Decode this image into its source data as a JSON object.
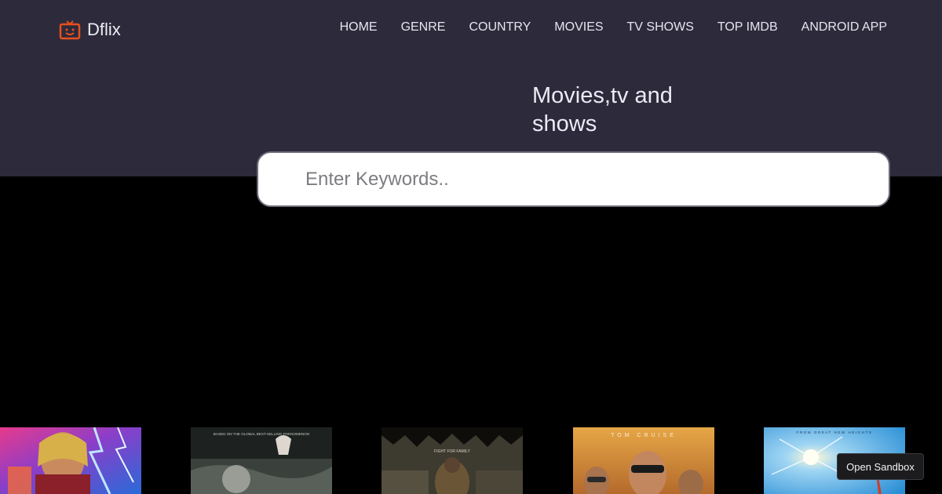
{
  "brand": {
    "name": "Dflix",
    "accent_color": "#e8501c"
  },
  "nav": {
    "items": [
      {
        "label": "HOME"
      },
      {
        "label": "GENRE"
      },
      {
        "label": "COUNTRY"
      },
      {
        "label": "MOVIES"
      },
      {
        "label": "TV SHOWS"
      },
      {
        "label": "TOP IMDB"
      },
      {
        "label": "ANDROID APP"
      }
    ]
  },
  "hero": {
    "tagline": "Movies,tv and shows"
  },
  "search": {
    "placeholder": "Enter Keywords.."
  },
  "posters": [
    {
      "name": "poster-1",
      "caption": ""
    },
    {
      "name": "poster-2",
      "caption": "BASED ON THE GLOBAL BEST-SELLING PHENOMENON"
    },
    {
      "name": "poster-3",
      "caption": "FIGHT FOR FAMILY"
    },
    {
      "name": "poster-4",
      "caption": "TOM CRUISE"
    },
    {
      "name": "poster-5",
      "caption": "FROM GREAT NEW HEIGHTS"
    }
  ],
  "sandbox": {
    "label": "Open Sandbox"
  },
  "colors": {
    "header_bg": "#2d2a3c",
    "page_bg": "#000000"
  }
}
